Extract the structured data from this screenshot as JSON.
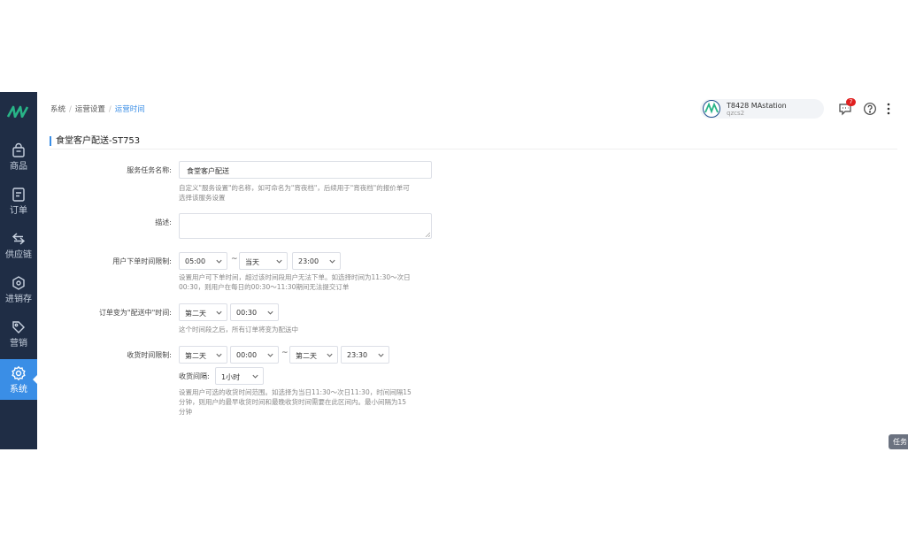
{
  "brand": {
    "logo_icon": "brand-logo-icon",
    "accent": "#3a8ee6",
    "sidebar_bg": "#1f2d45"
  },
  "sidebar": {
    "items": [
      {
        "label": "商品",
        "icon": "shopping-bag-icon"
      },
      {
        "label": "订单",
        "icon": "order-document-icon"
      },
      {
        "label": "供应链",
        "icon": "supply-chain-arrows-icon"
      },
      {
        "label": "进销存",
        "icon": "inventory-icon"
      },
      {
        "label": "营销",
        "icon": "tag-icon"
      },
      {
        "label": "系统",
        "icon": "gear-icon",
        "active": true
      }
    ]
  },
  "header": {
    "breadcrumb": [
      "系统",
      "运营设置",
      "运营时间"
    ],
    "user": {
      "name": "T8428 MAstation",
      "account": "qzcs2",
      "avatar_icon": "station-avatar-icon"
    },
    "notifications": {
      "count": "7",
      "icon": "message-icon"
    },
    "help_icon": "help-circle-icon",
    "more_icon": "more-vertical-icon"
  },
  "page": {
    "title": "食堂客户配送-ST753",
    "service_name": {
      "label": "服务任务名称:",
      "value": "食堂客户配送",
      "hint_line1": "自定义\"服务设置\"的名称，如可命名为\"宵夜档\"，后续用于\"宵夜档\"的报价单可",
      "hint_line2": "选择该服务设置"
    },
    "description": {
      "label": "描述:",
      "value": ""
    },
    "order_time": {
      "label": "用户下单时间限制:",
      "start_time": "05:00",
      "end_day": "当天",
      "end_time": "23:00",
      "hint_line1": "设置用户可下单时间，超过该时间段用户无法下单。如选择时间为11:30～次日",
      "hint_line2": "00:30，则用户在每日的00:30～11:30期间无法提交订单"
    },
    "delivering_time": {
      "label": "订单变为\"配送中\"时间:",
      "day": "第二天",
      "time": "00:30",
      "hint": "这个时间段之后，所有订单将变为配送中"
    },
    "receive_time": {
      "label": "收货时间限制:",
      "start_day": "第二天",
      "start_time": "00:00",
      "end_day": "第二天",
      "end_time": "23:30",
      "interval_label": "收货间隔:",
      "interval": "1小时",
      "hint_line1": "设置用户可选的收货时间范围。如选择为当日11:30～次日11:30，时间间隔15",
      "hint_line2": "分钟，则用户的最早收货时间和最晚收货时间需要在此区间内。最小间隔为15",
      "hint_line3": "分钟"
    },
    "range_separator": "~"
  },
  "task_tab": "任务"
}
